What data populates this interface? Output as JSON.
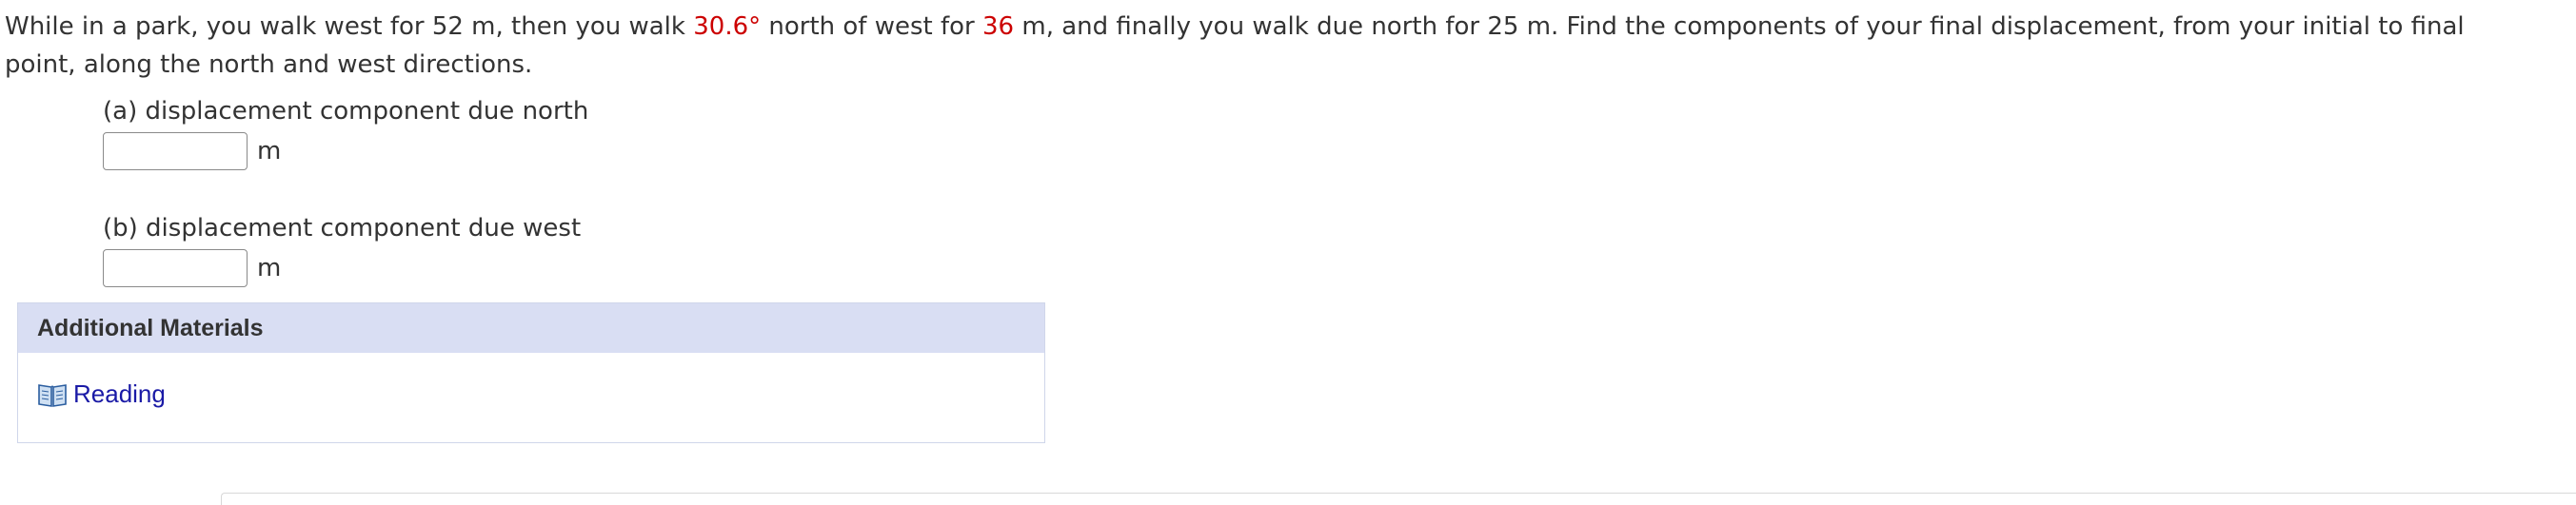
{
  "problem": {
    "seg1": "While in a park, you walk west for 52 m, then you walk ",
    "angle": "30.6°",
    "seg2": " north of west for ",
    "dist": "36",
    "seg3": " m, and finally you walk due north for 25 m. Find the components of your final displacement, from your initial to final point, along the north and west directions."
  },
  "parts": [
    {
      "label": "(a) displacement component due north",
      "unit": "m",
      "value": ""
    },
    {
      "label": "(b) displacement component due west",
      "unit": "m",
      "value": ""
    }
  ],
  "additional_materials": {
    "title": "Additional Materials",
    "icon": "book-icon",
    "link_label": "Reading"
  },
  "colors": {
    "highlight": "#cc0000",
    "link": "#1a1aa6",
    "header_bg": "#d9def3"
  }
}
